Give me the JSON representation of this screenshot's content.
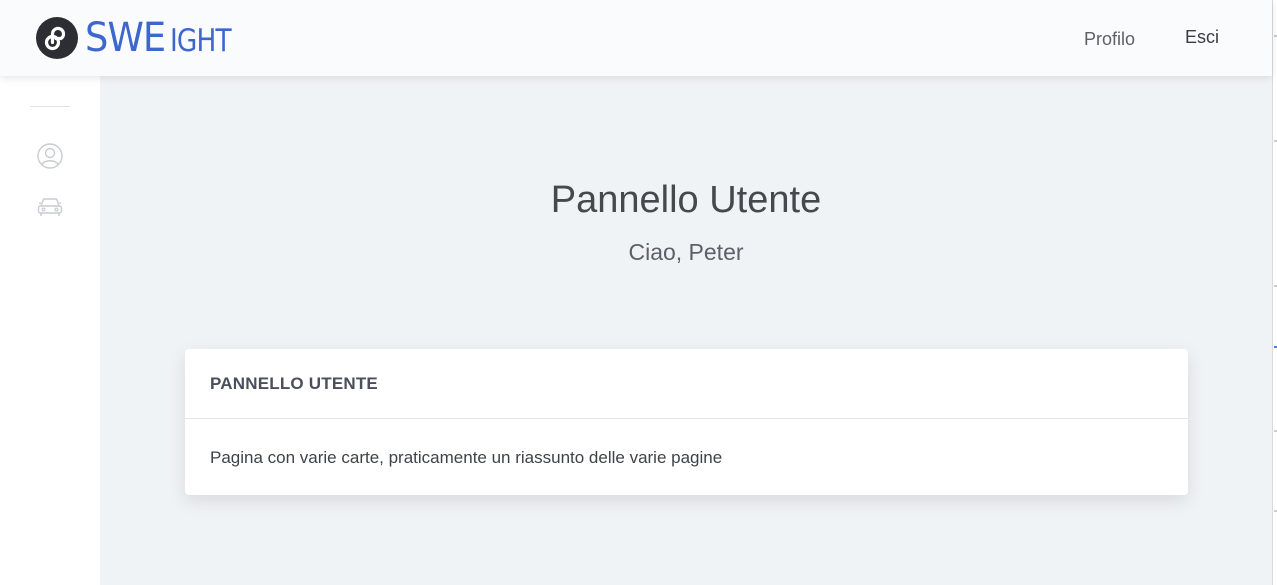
{
  "navbar": {
    "brand": {
      "big": "SWE",
      "small": "IGHT"
    },
    "links": {
      "profile": "Profilo",
      "logout": "Esci"
    }
  },
  "sidebar": {
    "items": [
      {
        "icon": "user-icon"
      },
      {
        "icon": "car-icon"
      }
    ]
  },
  "main": {
    "title": "Pannello Utente",
    "greeting": "Ciao, Peter",
    "card": {
      "header": "PANNELLO UTENTE",
      "body": "Pagina con varie carte, praticamente un riassunto delle varie pagine"
    }
  },
  "colors": {
    "brand": "#3d66cf",
    "navbar_bg": "#fafbfc",
    "content_bg": "#f0f3f6",
    "logo_circle": "#2c2e33"
  }
}
